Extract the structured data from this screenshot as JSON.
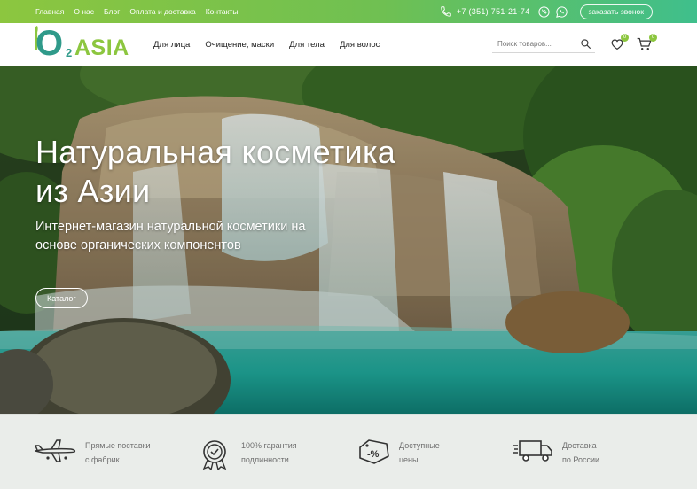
{
  "topbar": {
    "nav": [
      "Главная",
      "О нас",
      "Блог",
      "Оплата и доставка",
      "Контакты"
    ],
    "phone": "+7 (351) 751-21-74",
    "callback_label": "заказать звонок"
  },
  "header": {
    "logo": {
      "o": "O",
      "two": "2",
      "asia": "ASIA"
    },
    "nav": [
      "Для лица",
      "Очищение, маски",
      "Для тела",
      "Для волос"
    ],
    "search_placeholder": "Поиск товаров...",
    "wishlist_count": "0",
    "cart_count": "0"
  },
  "hero": {
    "title": "Натуральная косметика из Азии",
    "subtitle": "Интернет-магазин натуральной косметики на основе органических компонентов",
    "button_label": "Каталог"
  },
  "features": [
    {
      "icon": "airplane-icon",
      "text": "Прямые поставки\nс фабрик"
    },
    {
      "icon": "quality-badge-icon",
      "text": "100% гарантия\nподлинности"
    },
    {
      "icon": "discount-tag-icon",
      "text": "Доступные\nцены"
    },
    {
      "icon": "delivery-truck-icon",
      "text": "Доставка\nпо России"
    }
  ],
  "colors": {
    "brand_green": "#8cc63f",
    "brand_teal": "#2f9a8a",
    "topbar_gradient_end": "#3fbf8c"
  }
}
